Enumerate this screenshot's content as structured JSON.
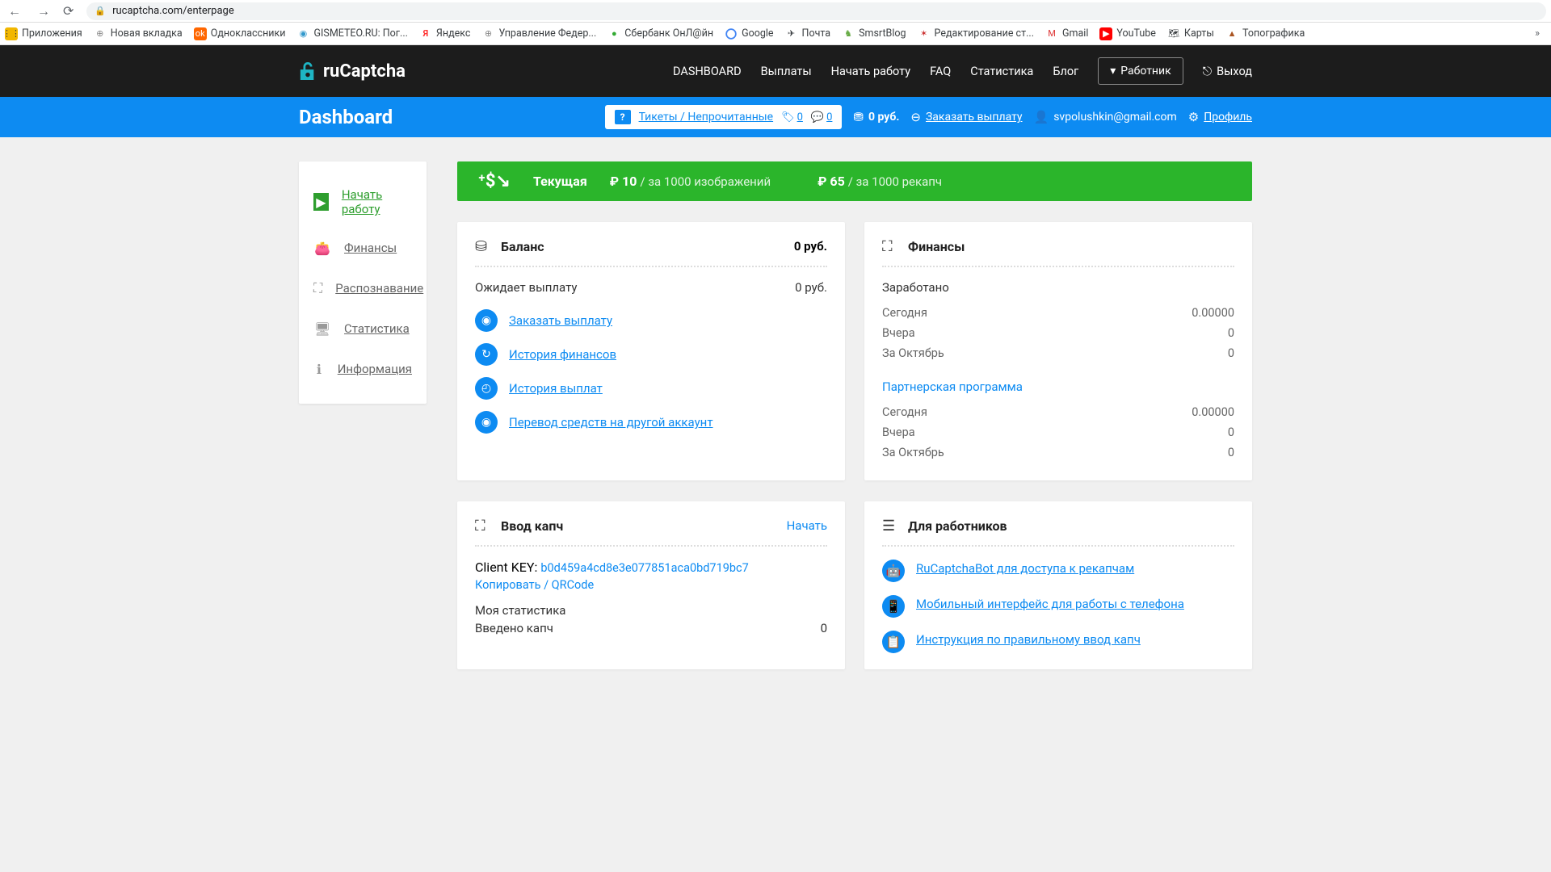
{
  "browser": {
    "url": "rucaptcha.com/enterpage",
    "bookmarks": [
      {
        "label": "Приложения"
      },
      {
        "label": "Новая вкладка"
      },
      {
        "label": "Одноклассники"
      },
      {
        "label": "GISMETEO.RU: Пог..."
      },
      {
        "label": "Яндекс"
      },
      {
        "label": "Управление Федер..."
      },
      {
        "label": "Сбербанк ОнЛ@йн"
      },
      {
        "label": "Google"
      },
      {
        "label": "Почта"
      },
      {
        "label": "SmsrtBlog"
      },
      {
        "label": "Редактирование ст..."
      },
      {
        "label": "Gmail"
      },
      {
        "label": "YouTube"
      },
      {
        "label": "Карты"
      },
      {
        "label": "Топографика"
      }
    ]
  },
  "header": {
    "logo": "ruCaptcha",
    "nav": [
      "DASHBOARD",
      "Выплаты",
      "Начать работу",
      "FAQ",
      "Статистика",
      "Блог"
    ],
    "worker_btn": "Работник",
    "logout": "Выход"
  },
  "bluebar": {
    "title": "Dashboard",
    "tickets_label": "Тикеты / Непрочитанные",
    "tickets_count1": "0",
    "tickets_count2": "0",
    "balance": "0 руб.",
    "order_payout": "Заказать выплату",
    "email": "svpolushkin@gmail.com",
    "profile": "Профиль"
  },
  "sidebar": {
    "items": [
      {
        "label": "Начать работу"
      },
      {
        "label": "Финансы"
      },
      {
        "label": "Распознавание"
      },
      {
        "label": "Статистика"
      },
      {
        "label": "Информация"
      }
    ]
  },
  "green": {
    "current": "Текущая",
    "price1_val": "₽ 10",
    "price1_per": "/ за 1000 изображений",
    "price2_val": "₽ 65",
    "price2_per": "/ за 1000 рекапч"
  },
  "balance_card": {
    "title": "Баланс",
    "value": "0 руб.",
    "pending_label": "Ожидает выплату",
    "pending_value": "0 руб.",
    "actions": [
      "Заказать выплату",
      "История финансов",
      "История выплат",
      "Перевод средств на другой аккаунт"
    ]
  },
  "finance_card": {
    "title": "Финансы",
    "earned_label": "Заработано",
    "rows": [
      {
        "label": "Сегодня",
        "value": "0.00000"
      },
      {
        "label": "Вчера",
        "value": "0"
      },
      {
        "label": "За Октябрь",
        "value": "0"
      }
    ],
    "partner_label": "Партнерская программа",
    "partner_rows": [
      {
        "label": "Сегодня",
        "value": "0.00000"
      },
      {
        "label": "Вчера",
        "value": "0"
      },
      {
        "label": "За Октябрь",
        "value": "0"
      }
    ]
  },
  "captcha_card": {
    "title": "Ввод капч",
    "start": "Начать",
    "key_label": "Client KEY:",
    "key_value": "b0d459a4cd8e3e077851aca0bd719bc7",
    "copy": "Копировать",
    "qr": "QRCode",
    "mystats": "Моя статистика",
    "entered_label": "Введено капч",
    "entered_value": "0"
  },
  "workers_card": {
    "title": "Для работников",
    "links": [
      "RuCaptchaBot для доступа к рекапчам",
      "Мобильный интерфейс для работы с телефона",
      "Инструкция по правильному ввод капч"
    ]
  }
}
